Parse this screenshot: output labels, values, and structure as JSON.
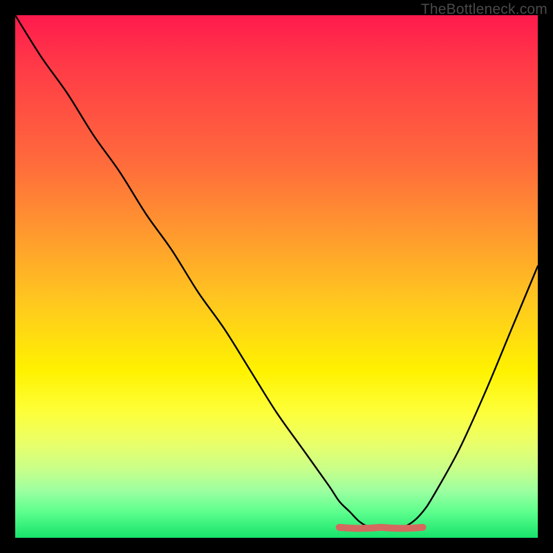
{
  "attribution": "TheBottleneck.com",
  "colors": {
    "frame": "#000000",
    "curve": "#000000",
    "marker": "#d46a5f",
    "gradient_top": "#ff1a4d",
    "gradient_bottom": "#17e36b"
  },
  "chart_data": {
    "type": "line",
    "title": "",
    "xlabel": "",
    "ylabel": "",
    "xlim": [
      0,
      100
    ],
    "ylim": [
      0,
      100
    ],
    "grid": false,
    "legend": false,
    "series": [
      {
        "name": "bottleneck-curve",
        "x": [
          0,
          5,
          10,
          15,
          20,
          25,
          30,
          35,
          40,
          45,
          50,
          55,
          60,
          62,
          64,
          66,
          68,
          70,
          72,
          74,
          76,
          78,
          80,
          85,
          90,
          95,
          100
        ],
        "y": [
          100,
          92,
          85,
          77,
          70,
          62,
          55,
          47,
          40,
          32,
          24,
          17,
          10,
          7,
          5,
          3,
          2,
          2,
          2,
          2,
          3,
          5,
          8,
          17,
          28,
          40,
          52
        ]
      }
    ],
    "annotations": [
      {
        "name": "optimal-range-marker",
        "type": "segment",
        "x": [
          62,
          78
        ],
        "y": [
          2,
          2
        ],
        "color": "#d46a5f"
      }
    ]
  }
}
